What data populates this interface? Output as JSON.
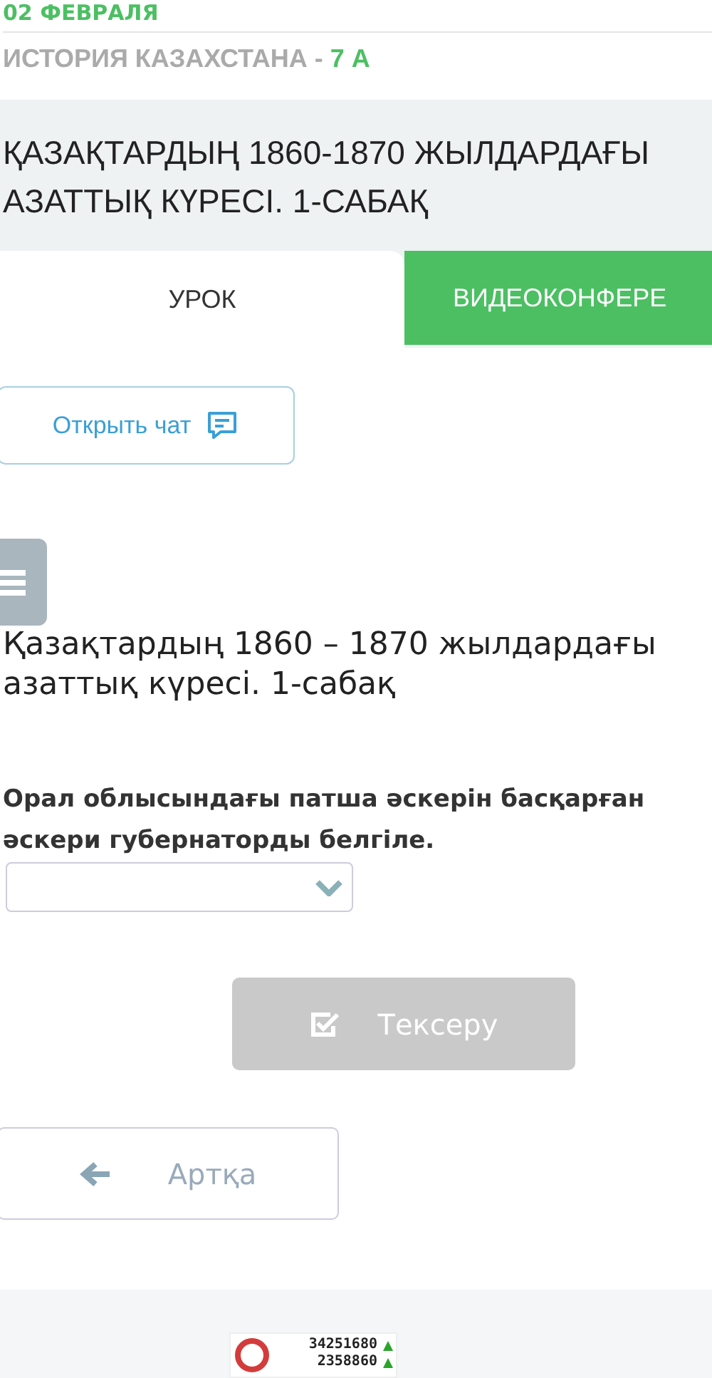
{
  "header": {
    "date": "02 ФЕВРАЛЯ",
    "subject": "ИСТОРИЯ КАЗАХСТАНА - ",
    "grade": "7 А"
  },
  "lesson_title": "ҚАЗАҚТАРДЫҢ 1860-1870 ЖЫЛДАРДАҒЫ АЗАТТЫҚ КҮРЕСІ. 1-САБАҚ",
  "tabs": [
    {
      "label": "УРОК",
      "selected": true
    },
    {
      "label": "ВИДЕОКОНФЕРЕ",
      "selected": false
    }
  ],
  "chat_button": {
    "label": "Открыть чат"
  },
  "content_title": "Қазақтардың 1860 – 1870 жылдардағы азаттық күресі. 1-сабақ",
  "question": "Орал облысындағы патша әскерін басқарған әскери губернаторды белгіле.",
  "check_button": {
    "label": "Тексеру",
    "disabled": true
  },
  "back_button": {
    "label": "Артқа"
  },
  "counter": {
    "total": "34251680",
    "today": "2358860"
  }
}
